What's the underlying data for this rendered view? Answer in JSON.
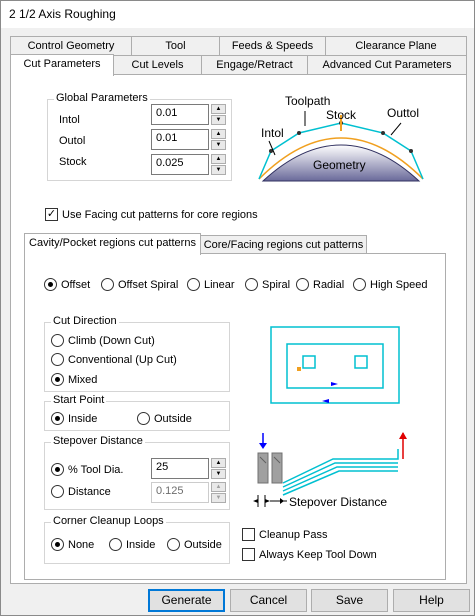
{
  "window": {
    "title": "2 1/2 Axis Roughing"
  },
  "tabs_row1": [
    "Control Geometry",
    "Tool",
    "Feeds & Speeds",
    "Clearance Plane"
  ],
  "tabs_row2": [
    "Cut Parameters",
    "Cut Levels",
    "Engage/Retract",
    "Advanced Cut Parameters"
  ],
  "global": {
    "title": "Global Parameters",
    "intol_label": "Intol",
    "intol_value": "0.01",
    "outol_label": "Outol",
    "outol_value": "0.01",
    "stock_label": "Stock",
    "stock_value": "0.025"
  },
  "diagram1": {
    "toolpath": "Toolpath",
    "stock": "Stock",
    "outtol": "Outtol",
    "intol": "Intol",
    "geometry": "Geometry"
  },
  "facing_check": {
    "label": "Use Facing cut patterns for core regions",
    "checked": true
  },
  "subtabs": [
    "Cavity/Pocket regions cut patterns",
    "Core/Facing regions cut patterns"
  ],
  "patterns": {
    "options": [
      "Offset",
      "Offset Spiral",
      "Linear",
      "Spiral",
      "Radial",
      "High Speed"
    ],
    "selected": "Offset"
  },
  "cut_direction": {
    "title": "Cut Direction",
    "options": [
      "Climb (Down Cut)",
      "Conventional (Up Cut)",
      "Mixed"
    ],
    "selected": "Mixed"
  },
  "start_point": {
    "title": "Start Point",
    "options": [
      "Inside",
      "Outside"
    ],
    "selected": "Inside"
  },
  "stepover": {
    "title": "Stepover Distance",
    "tool_dia_label": "% Tool Dia.",
    "tool_dia_value": "25",
    "distance_label": "Distance",
    "distance_value": "0.125",
    "selected": "% Tool Dia."
  },
  "corner_cleanup": {
    "title": "Corner Cleanup Loops",
    "options": [
      "None",
      "Inside",
      "Outside"
    ],
    "selected": "None"
  },
  "stepover_diagram_label": "Stepover Distance",
  "cleanup_pass": {
    "label": "Cleanup Pass",
    "checked": false
  },
  "keep_tool_down": {
    "label": "Always Keep Tool Down",
    "checked": false
  },
  "buttons": {
    "generate": "Generate",
    "cancel": "Cancel",
    "save": "Save",
    "help": "Help"
  },
  "colors": {
    "cyan": "#00c0d0",
    "orange": "#f0a020",
    "blue": "#0000ff",
    "red": "#e00000",
    "accent": "#0078d7"
  }
}
